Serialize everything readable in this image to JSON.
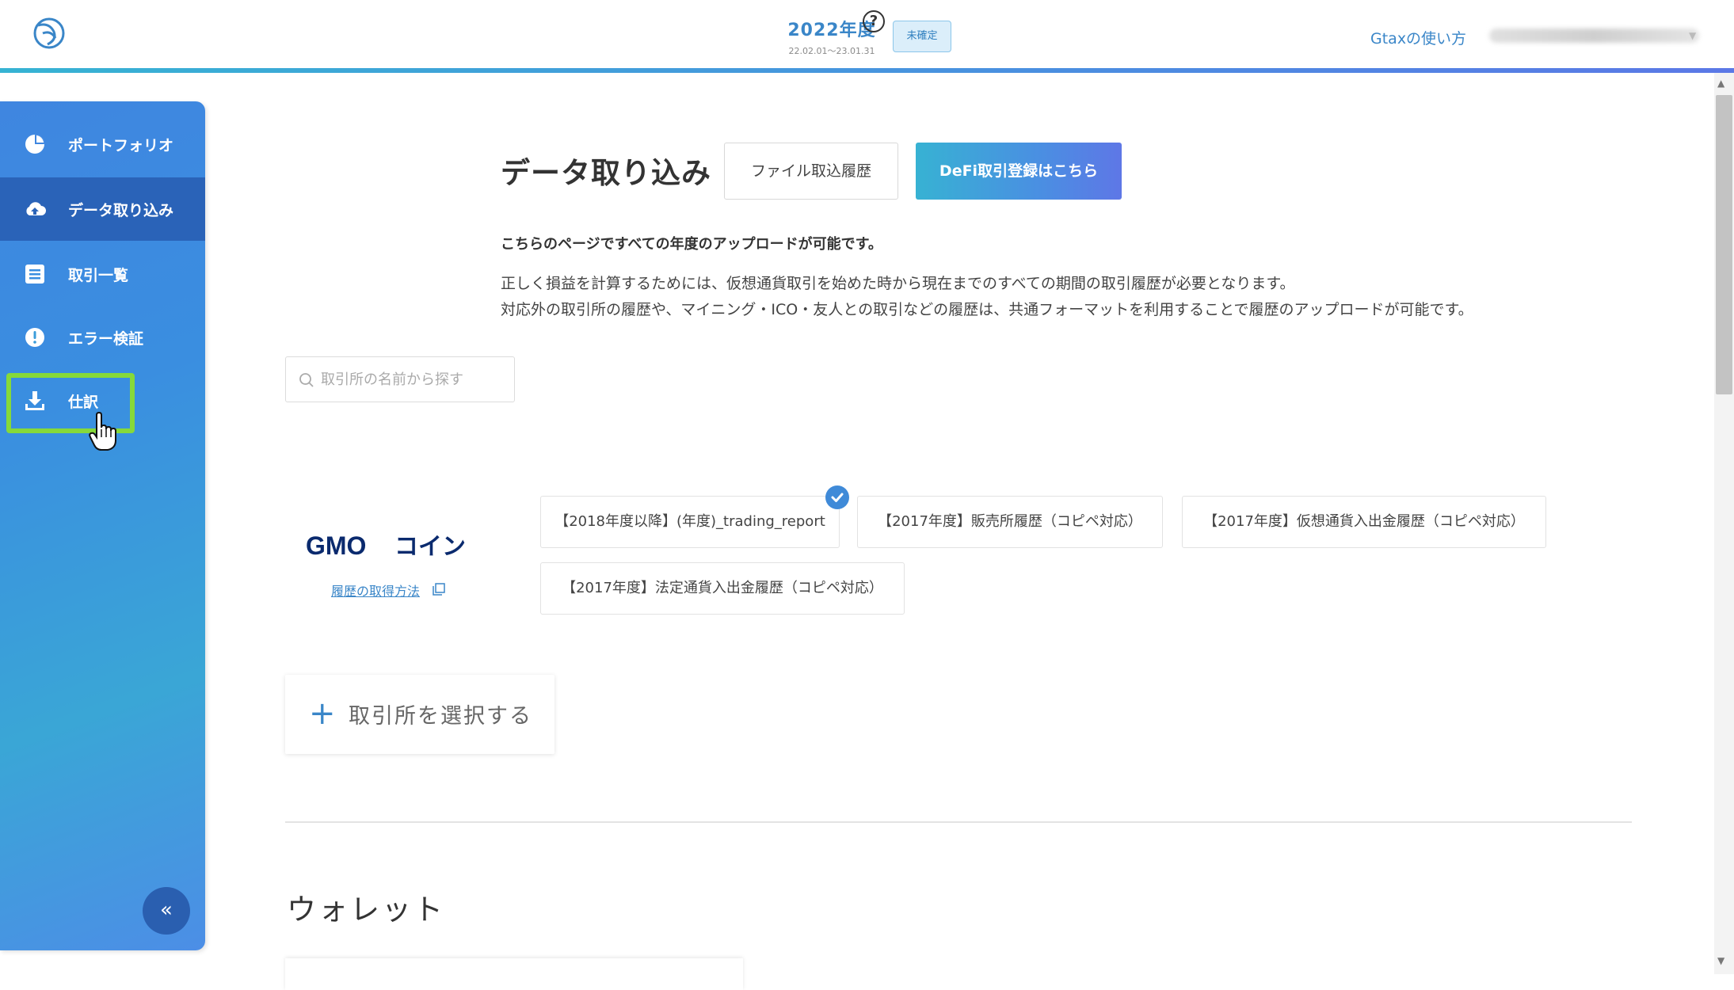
{
  "header": {
    "fiscal_year": "2022年度",
    "date_range": "22.02.01〜23.01.31",
    "help_label": "?",
    "status_badge": "未確定",
    "howto_link": "Gtaxの使い方"
  },
  "sidebar": {
    "items": [
      {
        "label": "ポートフォリオ",
        "icon": "pie-chart-icon"
      },
      {
        "label": "データ取り込み",
        "icon": "cloud-upload-icon",
        "active": true
      },
      {
        "label": "取引一覧",
        "icon": "list-icon"
      },
      {
        "label": "エラー検証",
        "icon": "alert-icon"
      },
      {
        "label": "仕訳",
        "icon": "download-icon",
        "highlighted": true
      }
    ],
    "collapse_label": "«"
  },
  "main": {
    "title": "データ取り込み",
    "history_button": "ファイル取込履歴",
    "defi_button": "DeFi取引登録はこちら",
    "intro_bold": "こちらのページですべての年度のアップロードが可能です。",
    "intro_line1": "正しく損益を計算するためには、仮想通貨取引を始めた時から現在までのすべての期間の取引履歴が必要となります。",
    "intro_line2": "対応外の取引所の履歴や、マイニング・ICO・友人との取引などの履歴は、共通フォーマットを利用することで履歴のアップロードが可能です。",
    "search": {
      "placeholder": "取引所の名前から探す",
      "value": ""
    },
    "exchange": {
      "logo_text_left": "GMO",
      "logo_text_right": "コイン",
      "history_link": "履歴の取得方法",
      "chips": [
        {
          "label": "【2018年度以降】(年度)_trading_report",
          "checked": true
        },
        {
          "label": "【2017年度】販売所履歴（コピペ対応）",
          "checked": false
        },
        {
          "label": "【2017年度】仮想通貨入出金履歴（コピペ対応）",
          "checked": false
        },
        {
          "label": "【2017年度】法定通貨入出金履歴（コピペ対応）",
          "checked": false
        }
      ]
    },
    "add_exchange": {
      "plus": "+",
      "label": "取引所を選択する"
    },
    "wallet_heading": "ウォレット"
  },
  "colors": {
    "accent": "#3a86c8",
    "sidebar_active": "#2a63b8",
    "highlight": "#86d93a",
    "check": "#3f8ad8"
  }
}
